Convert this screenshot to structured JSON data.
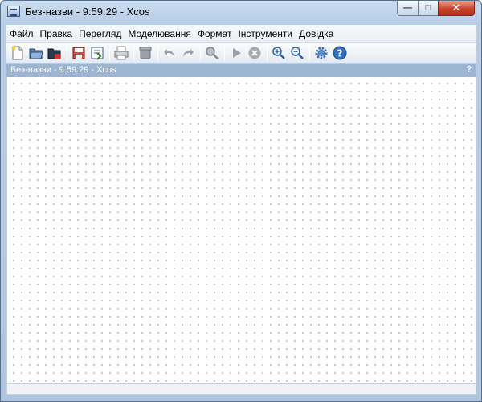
{
  "window": {
    "title": "Без-назви - 9:59:29 - Xcos",
    "minimize_label": "—",
    "maximize_label": "□",
    "close_label": "✕"
  },
  "menu": {
    "items": [
      "Файл",
      "Правка",
      "Перегляд",
      "Моделювання",
      "Формат",
      "Інструменти",
      "Довідка"
    ]
  },
  "toolbar": {
    "icons": [
      "new-diagram-icon",
      "open-icon",
      "open-in-scilab-icon",
      "save-icon",
      "save-as-icon",
      "print-icon",
      "delete-icon",
      "undo-icon",
      "redo-icon",
      "fit-diagram-icon",
      "start-icon",
      "stop-icon",
      "zoom-in-icon",
      "zoom-out-icon",
      "setup-icon",
      "help-icon"
    ]
  },
  "document": {
    "title": "Без-назви - 9:59:29 - Xcos",
    "help": "?"
  },
  "colors": {
    "titlebar": "#b7cde6",
    "doc_header": "#9db5d1",
    "close_button": "#c7432b",
    "grid_dot": "#b9b9b9"
  }
}
